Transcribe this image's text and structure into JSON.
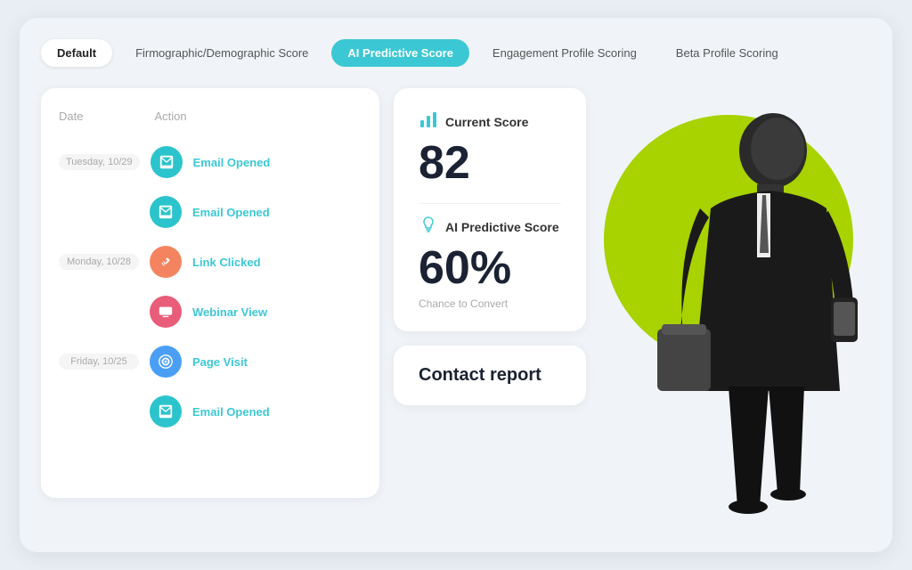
{
  "tabs": [
    {
      "id": "default",
      "label": "Default",
      "state": "active-default"
    },
    {
      "id": "firmographic",
      "label": "Firmographic/Demographic Score",
      "state": ""
    },
    {
      "id": "ai-predictive",
      "label": "AI Predictive Score",
      "state": "active-ai"
    },
    {
      "id": "engagement",
      "label": "Engagement Profile Scoring",
      "state": ""
    },
    {
      "id": "beta",
      "label": "Beta Profile Scoring",
      "state": ""
    }
  ],
  "activity": {
    "col_date": "Date",
    "col_action": "Action",
    "rows": [
      {
        "date": "Tuesday, 10/29",
        "icon_color": "icon-teal",
        "icon": "✉",
        "action": "Email Opened"
      },
      {
        "date": "",
        "icon_color": "icon-teal",
        "icon": "✉",
        "action": "Email Opened"
      },
      {
        "date": "Monday, 10/28",
        "icon_color": "icon-orange",
        "icon": "🔗",
        "action": "Link Clicked"
      },
      {
        "date": "",
        "icon_color": "icon-pink",
        "icon": "▶",
        "action": "Webinar View"
      },
      {
        "date": "Friday, 10/25",
        "icon_color": "icon-blue",
        "icon": "◎",
        "action": "Page Visit"
      },
      {
        "date": "",
        "icon_color": "icon-teal",
        "icon": "✉",
        "action": "Email Opened"
      }
    ]
  },
  "score_panel": {
    "current_score_label": "Current Score",
    "current_score_value": "82",
    "predictive_label": "AI Predictive Score",
    "predictive_value": "60%",
    "chance_label": "Chance to Convert"
  },
  "contact_report": {
    "label": "Contact report"
  },
  "colors": {
    "teal": "#2bc4cc",
    "orange": "#f4845f",
    "pink": "#e85d7a",
    "blue": "#4a9ff5",
    "green_circle": "#a8d200",
    "action_text": "#3bc8d4"
  }
}
